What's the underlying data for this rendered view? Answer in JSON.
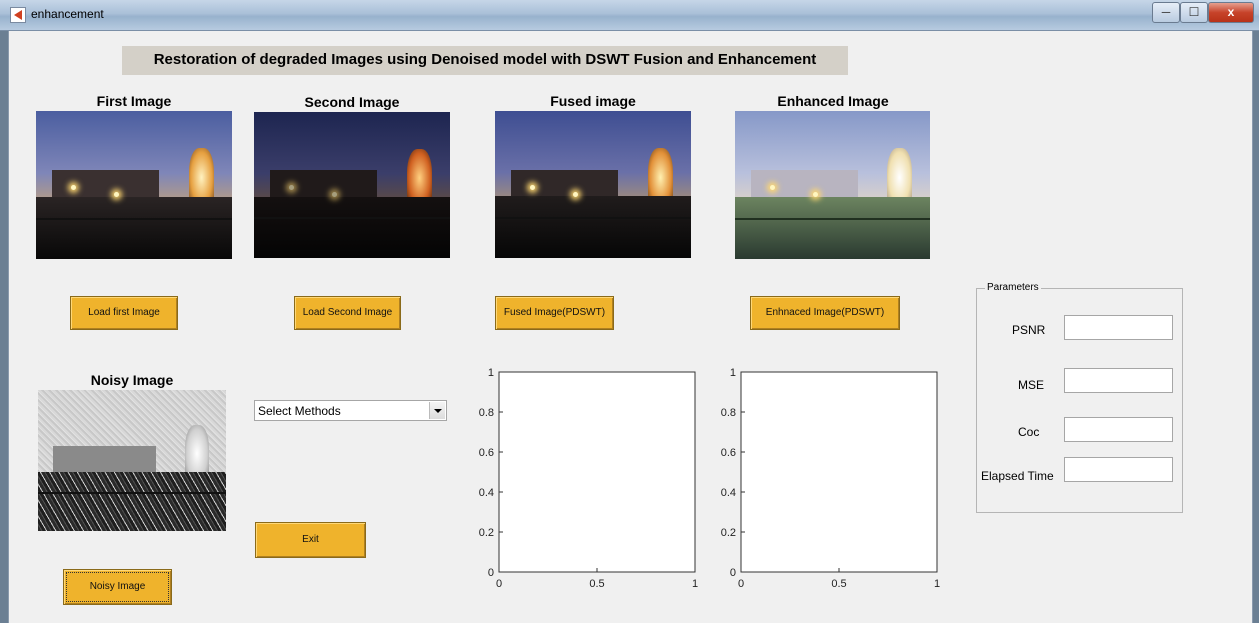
{
  "window": {
    "title": "enhancement",
    "close_label": "x"
  },
  "heading": "Restoration of degraded Images using Denoised model with DSWT Fusion and Enhancement",
  "images": {
    "first": {
      "title": "First Image"
    },
    "second": {
      "title": "Second Image"
    },
    "fused": {
      "title": "Fused image"
    },
    "enhanced": {
      "title": "Enhanced Image"
    },
    "noisy": {
      "title": "Noisy Image"
    }
  },
  "buttons": {
    "load_first": "Load first Image",
    "load_second": "Load Second Image",
    "fused": "Fused Image(PDSWT)",
    "enhanced": "Enhnaced Image(PDSWT)",
    "noisy": "Noisy Image",
    "exit": "Exit"
  },
  "select": {
    "value": "Select Methods"
  },
  "axes": [
    {
      "xlim": [
        0,
        1
      ],
      "ylim": [
        0,
        1
      ],
      "xticks": [
        "0",
        "0.5",
        "1"
      ],
      "yticks": [
        "0",
        "0.2",
        "0.4",
        "0.6",
        "0.8",
        "1"
      ]
    },
    {
      "xlim": [
        0,
        1
      ],
      "ylim": [
        0,
        1
      ],
      "xticks": [
        "0",
        "0.5",
        "1"
      ],
      "yticks": [
        "0",
        "0.2",
        "0.4",
        "0.6",
        "0.8",
        "1"
      ]
    }
  ],
  "parameters": {
    "title": "Parameters",
    "psnr_label": "PSNR",
    "mse_label": "MSE",
    "coc_label": "Coc",
    "elapsed_label": "Elapsed Time",
    "psnr_value": "",
    "mse_value": "",
    "coc_value": "",
    "elapsed_value": ""
  },
  "colors": {
    "button": "#efb32c",
    "background": "#f0f0f0"
  }
}
